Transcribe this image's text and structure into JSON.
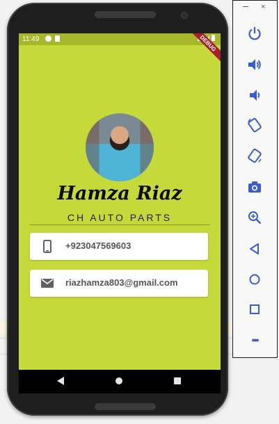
{
  "status_bar": {
    "time": "11:49"
  },
  "debug_banner": "DEBUG",
  "profile": {
    "name": "Hamza Riaz",
    "subtitle": "CH AUTO PARTS"
  },
  "contact": {
    "phone": "+923047569603",
    "email": "riazhamza803@gmail.com"
  },
  "emulator_panel": {
    "minimize_label": "−",
    "close_label": "×",
    "more_label": "•••"
  },
  "colors": {
    "screen_bg": "#c6d93a",
    "status_bar_bg": "#a7b72c",
    "card_bg": "#ffffff"
  }
}
